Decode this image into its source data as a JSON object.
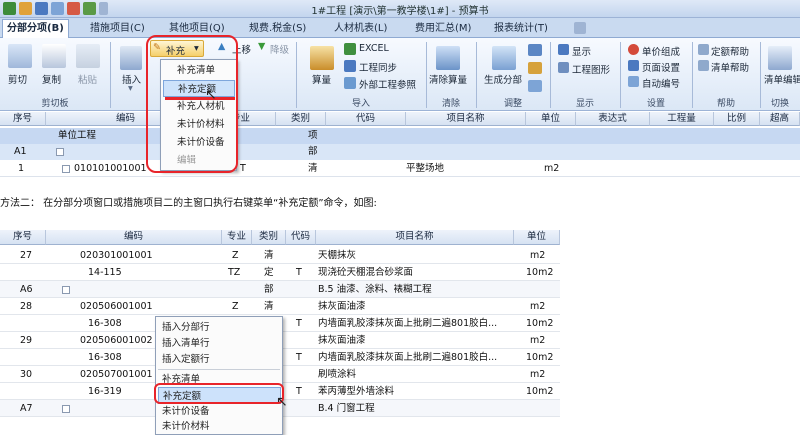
{
  "window": {
    "title": "1#工程 [演示\\第一教学楼\\1#] - 预算书"
  },
  "tabs": [
    "分部分项(B)",
    "措施项目(C)",
    "其他项目(Q)",
    "规费.税金(S)",
    "人材机表(L)",
    "费用汇总(M)",
    "报表统计(T)"
  ],
  "ribbon": {
    "cut": "剪切",
    "copy": "复制",
    "paste": "粘贴",
    "clipboard_group": "剪切板",
    "insert": "插入",
    "supplement_dropdown": "补充",
    "up": "上移",
    "down": "降级",
    "excel": "EXCEL",
    "measure": "算量",
    "project_sync": "工程同步",
    "external_ref": "外部工程参照",
    "import_group": "导入",
    "clear_measure": "清除算量",
    "clear_group": "清除",
    "gen_division": "生成分部",
    "adjust_group": "调整",
    "display": "显示",
    "project_graph": "工程图形",
    "display_group": "显示",
    "quota_compose": "单价组成",
    "page_setup": "页面设置",
    "auto_number": "自动编号",
    "settings_group": "设置",
    "quota_help": "定额帮助",
    "list_help": "清单帮助",
    "help_group": "帮助",
    "list_edit": "清单编辑",
    "switch_group": "切换"
  },
  "menu1": {
    "items": [
      "补充清单",
      "补充定额",
      "补充人材机",
      "未计价材料",
      "未计价设备",
      "编辑"
    ],
    "highlighted": "补充定额"
  },
  "grid1": {
    "headers": [
      "序号",
      "编码",
      "专业",
      "类别",
      "代码",
      "项目名称",
      "单位",
      "表达式",
      "工程量",
      "比例",
      "超高"
    ],
    "rows": [
      {
        "seq": "",
        "code": "单位工程",
        "type": "项",
        "name": "",
        "unit": ""
      },
      {
        "seq": "A1",
        "code": "",
        "type": "部",
        "name": "",
        "unit": ""
      },
      {
        "seq": "1",
        "code": "010101001001",
        "spec": "T",
        "type": "清",
        "name": "平整场地",
        "unit": "m2"
      }
    ]
  },
  "instruction": "方法二： 在分部分项窗口或措施项目二的主窗口执行右键菜单“补充定额”命令，如图:",
  "grid2": {
    "headers": [
      "序号",
      "编码",
      "专业",
      "类别",
      "代码",
      "项目名称",
      "单位"
    ],
    "rows": [
      {
        "seq": "27",
        "code": "020301001001",
        "spec": "Z",
        "type": "清",
        "dm": "",
        "name": "天棚抹灰",
        "unit": "m2"
      },
      {
        "seq": "",
        "code": "14-115",
        "spec": "TZ",
        "type": "定",
        "dm": "T",
        "name": "现浇砼天棚混合砂浆面",
        "unit": "10m2"
      },
      {
        "seq": "A6",
        "code": "",
        "spec": "",
        "type": "部",
        "dm": "",
        "name": "B.5 油漆、涂料、裱糊工程",
        "unit": ""
      },
      {
        "seq": "28",
        "code": "020506001001",
        "spec": "Z",
        "type": "清",
        "dm": "",
        "name": "抹灰面油漆",
        "unit": "m2"
      },
      {
        "seq": "",
        "code": "16-308",
        "spec": "",
        "type": "",
        "dm": "T",
        "name": "内墙面乳胶漆抹灰面上批刷二遍801胶白...",
        "unit": "10m2"
      },
      {
        "seq": "29",
        "code": "020506001002",
        "spec": "",
        "type": "",
        "dm": "",
        "name": "抹灰面油漆",
        "unit": "m2"
      },
      {
        "seq": "",
        "code": "16-308",
        "spec": "",
        "type": "",
        "dm": "T",
        "name": "内墙面乳胶漆抹灰面上批刷二遍801胶白...",
        "unit": "10m2"
      },
      {
        "seq": "30",
        "code": "020507001001",
        "spec": "",
        "type": "",
        "dm": "",
        "name": "刷喷涂料",
        "unit": "m2"
      },
      {
        "seq": "",
        "code": "16-319",
        "spec": "",
        "type": "",
        "dm": "T",
        "name": "苯丙薄型外墙涂料",
        "unit": "10m2"
      },
      {
        "seq": "A7",
        "code": "",
        "spec": "",
        "type": "",
        "dm": "",
        "name": "B.4 门窗工程",
        "unit": ""
      }
    ]
  },
  "menu2": {
    "items": [
      "插入分部行",
      "插入清单行",
      "插入定额行",
      "补充清单",
      "补充定额",
      "未计价设备",
      "未计价材料"
    ],
    "highlighted": "补充定额"
  },
  "colors": {
    "accent_red": "#e8242a",
    "ribbon_blue": "#c9daf0",
    "highlight": "#cde2fb"
  }
}
